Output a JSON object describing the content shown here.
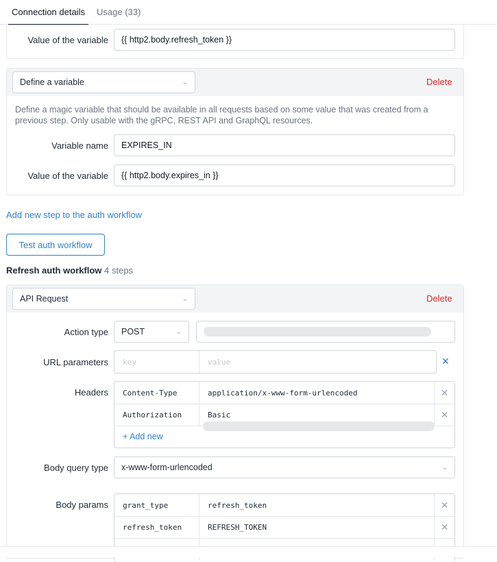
{
  "tabs": [
    {
      "label": "Connection details"
    },
    {
      "label": "Usage (33)"
    }
  ],
  "top_step": {
    "value_label": "Value of the variable",
    "value": "{{ http2.body.refresh_token }}"
  },
  "define_step": {
    "select_value": "Define a variable",
    "delete_label": "Delete",
    "description": "Define a magic variable that should be available in all requests based on some value that was created from a previous step. Only usable with the gRPC, REST API and GraphQL resources.",
    "name_label": "Variable name",
    "name_value": "EXPIRES_IN",
    "value_label": "Value of the variable",
    "value": "{{ http2.body.expires_in }}"
  },
  "add_step_label": "Add new step to the auth workflow",
  "test_button_label": "Test auth workflow",
  "refresh_section": {
    "title": "Refresh auth workflow",
    "steps_count": "4 steps"
  },
  "api_step": {
    "select_value": "API Request",
    "delete_label": "Delete",
    "action_type_label": "Action type",
    "action_type_value": "POST",
    "url_params_label": "URL parameters",
    "url_params_key_placeholder": "key",
    "url_params_value_placeholder": "value",
    "headers_label": "Headers",
    "headers": [
      {
        "key": "Content-Type",
        "value": "application/x-www-form-urlencoded"
      },
      {
        "key": "Authorization",
        "value": "Basic"
      }
    ],
    "add_new_label": "+ Add new",
    "body_query_type_label": "Body query type",
    "body_query_type_value": "x-www-form-urlencoded",
    "body_params_label": "Body params",
    "body_params": [
      {
        "key": "grant_type",
        "value": "refresh_token"
      },
      {
        "key": "refresh_token",
        "value": "REFRESH_TOKEN"
      }
    ]
  },
  "icons": {
    "chevron": "chevron-down-icon",
    "close": "close-icon"
  },
  "colors": {
    "accent": "#2f80d1",
    "danger": "#dc2626",
    "border": "#d1d5db",
    "panel_head": "#f3f4f6"
  }
}
